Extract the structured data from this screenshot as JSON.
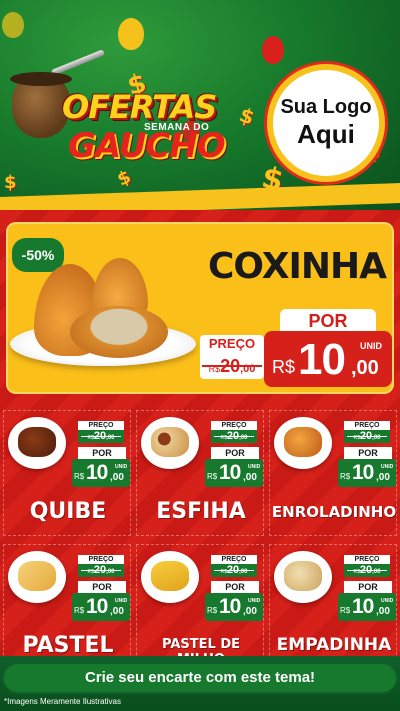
{
  "header": {
    "title_line1": "OFERTAS",
    "title_sub": "SEMANA DO",
    "title_line2": "GAUCHO",
    "logo_line1": "Sua Logo",
    "logo_line2": "Aqui"
  },
  "featured": {
    "discount": "-50%",
    "name": "COXINHA",
    "preco_label": "PREÇO",
    "old_currency": "R$",
    "old_int": "20",
    "old_dec": ",00",
    "por_label": "POR",
    "currency": "R$",
    "price_int": "10",
    "price_dec": ",00",
    "unit": "UNID"
  },
  "products": [
    {
      "name": "QUIBE",
      "preco_label": "PREÇO",
      "old_currency": "R$",
      "old_int": "20",
      "old_dec": ",00",
      "por_label": "POR",
      "currency": "R$",
      "price_int": "10",
      "price_dec": ",00",
      "unit": "UNID"
    },
    {
      "name": "ESFIHA",
      "preco_label": "PREÇO",
      "old_currency": "R$",
      "old_int": "20",
      "old_dec": ",00",
      "por_label": "POR",
      "currency": "R$",
      "price_int": "10",
      "price_dec": ",00",
      "unit": "UNID"
    },
    {
      "name": "ENROLADINHO",
      "preco_label": "PREÇO",
      "old_currency": "R$",
      "old_int": "20",
      "old_dec": ",00",
      "por_label": "POR",
      "currency": "R$",
      "price_int": "10",
      "price_dec": ",00",
      "unit": "UNID"
    },
    {
      "name": "PASTEL",
      "preco_label": "PREÇO",
      "old_currency": "R$",
      "old_int": "20",
      "old_dec": ",00",
      "por_label": "POR",
      "currency": "R$",
      "price_int": "10",
      "price_dec": ",00",
      "unit": "UNID"
    },
    {
      "name": "PASTEL DE MILHO",
      "preco_label": "PREÇO",
      "old_currency": "R$",
      "old_int": "20",
      "old_dec": ",00",
      "por_label": "POR",
      "currency": "R$",
      "price_int": "10",
      "price_dec": ",00",
      "unit": "UNID"
    },
    {
      "name": "EMPADINHA",
      "preco_label": "PREÇO",
      "old_currency": "R$",
      "old_int": "20",
      "old_dec": ",00",
      "por_label": "POR",
      "currency": "R$",
      "price_int": "10",
      "price_dec": ",00",
      "unit": "UNID"
    }
  ],
  "cta": {
    "label": "Crie seu encarte com este tema!"
  },
  "footer": {
    "disclaimer": "*Imagens Meramente Ilustrativas"
  },
  "colors": {
    "red": "#d6201a",
    "green": "#16792d",
    "yellow": "#fbbf1a",
    "dark_green": "#0f5f2b"
  },
  "icons": [
    "balloon-icon",
    "dollar-icon",
    "cuia-icon",
    "food-photo-icon"
  ]
}
